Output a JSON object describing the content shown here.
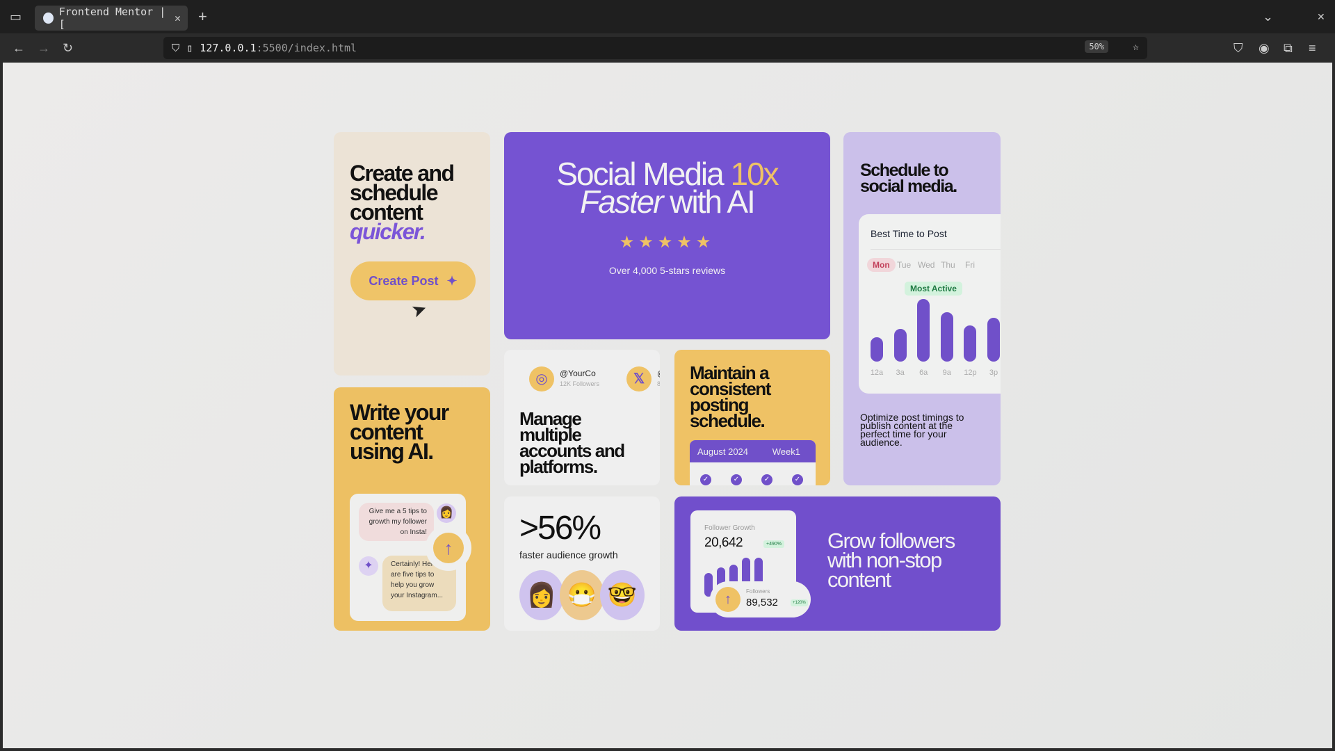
{
  "browser": {
    "tab_title": "Frontend Mentor | [",
    "url_host": "127.0.0.1",
    "url_path": ":5500/index.html",
    "zoom": "50%"
  },
  "colors": {
    "purple": "#7553d2",
    "yellow": "#efc265",
    "cream": "#ede3d6",
    "lavender": "#cdc3ec"
  },
  "card_create": {
    "line1": "Create and",
    "line2": "schedule",
    "line3": "content",
    "accent": "quicker.",
    "button": "Create Post"
  },
  "hero": {
    "line1a": "Social Media ",
    "line1b": "10x",
    "line2a": "Faster",
    "line2b": " with AI",
    "stars": 5,
    "reviews": "Over 4,000 5-stars reviews"
  },
  "schedule": {
    "title1": "Schedule to",
    "title2": "social media.",
    "chart_title": "Best Time to Post",
    "days": [
      "Mon",
      "Tue",
      "Wed",
      "Thu",
      "Fri"
    ],
    "active_day": "Mon",
    "badge": "Most Active",
    "times": [
      "12a",
      "3a",
      "6a",
      "9a",
      "12p",
      "3p"
    ],
    "levels": [
      35,
      47,
      90,
      71,
      52,
      63
    ],
    "description": "Optimize post timings to publish content at the perfect time for your audience."
  },
  "write": {
    "title1": "Write your",
    "title2": "content",
    "title3": "using AI.",
    "prompt": "Give me a 5 tips to growth my follower on Insta!",
    "reply": "Certainly! Here are five tips to help you grow your Instagram..."
  },
  "manage": {
    "handle": "@YourCo",
    "followers": "12K Followers",
    "handle2": "@",
    "followers2": "8",
    "title1": "Manage",
    "title2": "multiple",
    "title3": "accounts and",
    "title4": "platforms."
  },
  "maintain": {
    "title1": "Maintain a",
    "title2": "consistent",
    "title3": "posting",
    "title4": "schedule.",
    "month": "August 2024",
    "week": "Week1"
  },
  "growth": {
    "stat": ">56%",
    "label": "faster audience growth"
  },
  "grow": {
    "card_label": "Follower Growth",
    "count": "20,642",
    "count_change": "+490%",
    "followers_label": "Followers",
    "followers": "89,532",
    "followers_change": "+120%",
    "title1": "Grow followers",
    "title2": "with non-stop",
    "title3": "content"
  }
}
